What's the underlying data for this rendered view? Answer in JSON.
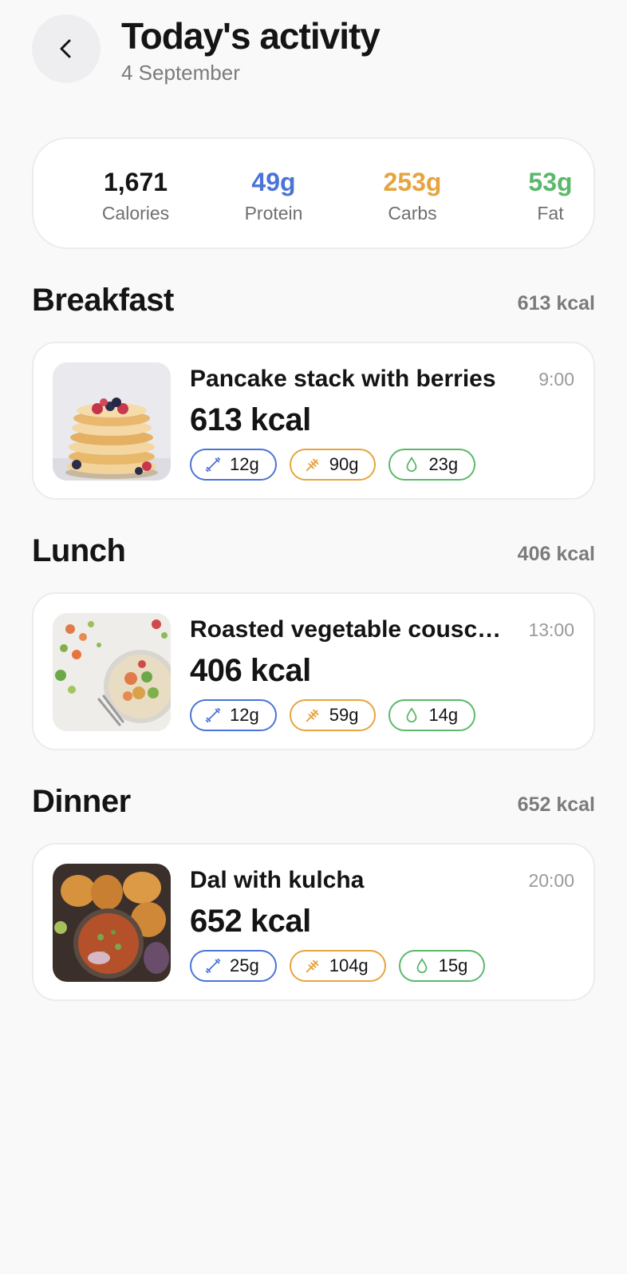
{
  "header": {
    "title": "Today's activity",
    "date": "4 September"
  },
  "summary": {
    "calories": {
      "value": "1,671",
      "label": "Calories",
      "color": "#141414"
    },
    "protein": {
      "value": "49g",
      "label": "Protein",
      "color": "#4b74d6"
    },
    "carbs": {
      "value": "253g",
      "label": "Carbs",
      "color": "#e6a43f"
    },
    "fat": {
      "value": "53g",
      "label": "Fat",
      "color": "#5bb86a"
    }
  },
  "colors": {
    "protein": "#4b74d6",
    "carbs": "#e6a43f",
    "fat": "#5bb86a"
  },
  "icons": {
    "back": "chevron-left-icon",
    "protein": "dumbbell-icon",
    "carbs": "wheat-icon",
    "fat": "drop-icon"
  },
  "meals": [
    {
      "section": "Breakfast",
      "section_kcal": "613 kcal",
      "name": "Pancake stack with berries",
      "time": "9:00",
      "kcal": "613 kcal",
      "protein": "12g",
      "carbs": "90g",
      "fat": "23g"
    },
    {
      "section": "Lunch",
      "section_kcal": "406 kcal",
      "name": "Roasted vegetable couscous",
      "time": "13:00",
      "kcal": "406 kcal",
      "protein": "12g",
      "carbs": "59g",
      "fat": "14g"
    },
    {
      "section": "Dinner",
      "section_kcal": "652 kcal",
      "name": "Dal with kulcha",
      "time": "20:00",
      "kcal": "652 kcal",
      "protein": "25g",
      "carbs": "104g",
      "fat": "15g"
    }
  ]
}
